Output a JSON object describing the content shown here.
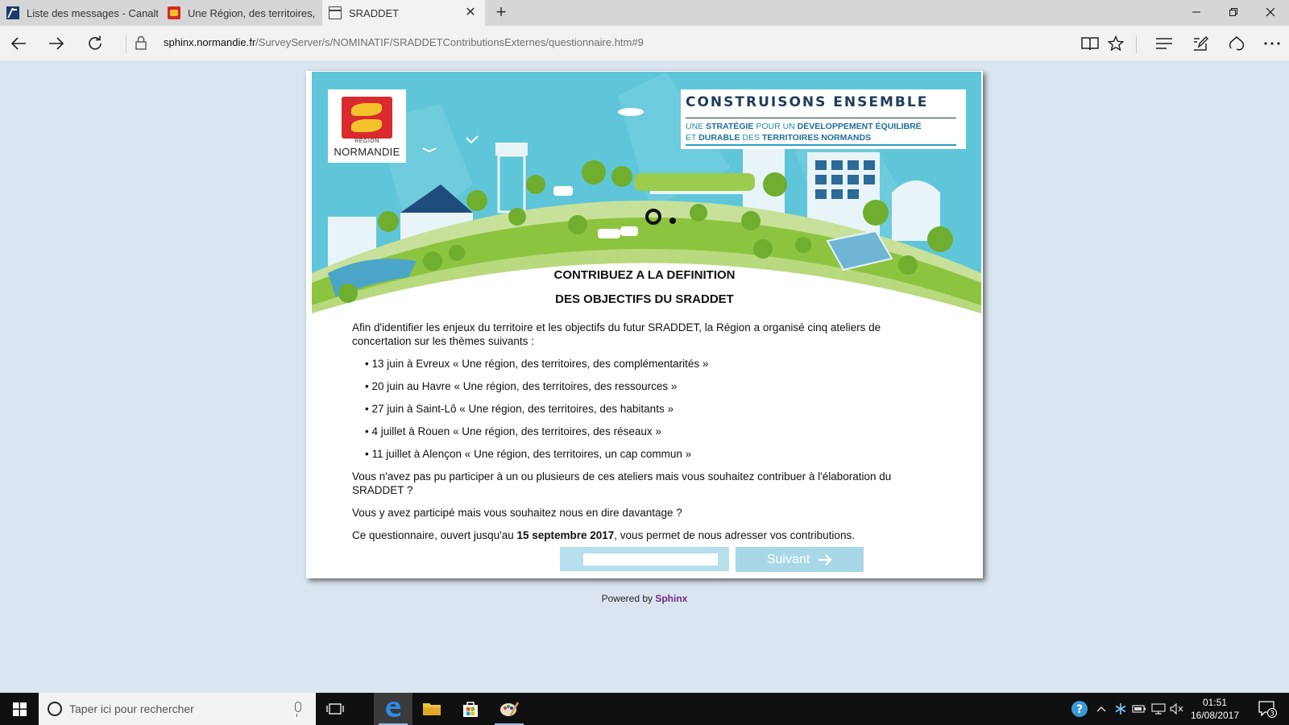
{
  "browser": {
    "tabs": [
      {
        "title": "Liste des messages - Canalt",
        "favicon": "outlook-icon"
      },
      {
        "title": "Une Région, des territoires,",
        "favicon": "region-normandie-icon"
      },
      {
        "title": "SRADDET",
        "favicon": "page-icon",
        "active": true
      }
    ],
    "url_host": "sphinx.normandie.fr",
    "url_path": "/SurveyServer/s/NOMINATIF/SRADDETContributionsExternes/questionnaire.htm#9"
  },
  "banner": {
    "logo_small": "RÉGION",
    "logo_big": "NORMANDIE",
    "slogan_title": "CONSTRUISONS ENSEMBLE",
    "slogan_line1_a": "UNE ",
    "slogan_line1_b": "STRATÉGIE",
    "slogan_line1_c": " POUR UN ",
    "slogan_line1_d": "DÉVELOPPEMENT ÉQUILIBRÉ",
    "slogan_line2_a": "ET ",
    "slogan_line2_b": "DURABLE",
    "slogan_line2_c": " DES ",
    "slogan_line2_d": "TERRITOIRES NORMANDS"
  },
  "survey": {
    "heading_line1": "CONTRIBUEZ A LA DEFINITION",
    "heading_line2": "DES OBJECTIFS DU SRADDET",
    "intro": "Afin d'identifier les enjeux du territoire et les objectifs du futur SRADDET, la Région a organisé cinq ateliers de concertation sur les thèmes suivants :",
    "workshops": [
      "• 13 juin à Evreux « Une région, des territoires, des complémentarités »",
      "• 20 juin au Havre « Une région, des territoires, des ressources »",
      "• 27 juin à Saint-Lô « Une région, des territoires, des habitants »",
      "• 4 juillet à Rouen « Une région, des territoires, des réseaux »",
      "• 11 juillet à Alençon « Une région, des territoires, un cap commun »"
    ],
    "question1": "Vous n'avez pas pu participer à un ou plusieurs de ces ateliers mais vous souhaitez contribuer à l'élaboration du SRADDET ?",
    "question2": "Vous y avez participé mais vous souhaitez nous en dire davantage ?",
    "closing_before": "Ce questionnaire, ouvert jusqu'au ",
    "closing_date": "15 septembre 2017",
    "closing_after": ", vous permet de nous adresser vos contributions.",
    "progress_fraction": 0.1,
    "next_label": "Suivant"
  },
  "footer": {
    "powered_by": "Powered by",
    "brand": "Sphinx"
  },
  "taskbar": {
    "search_placeholder": "Taper ici pour rechercher",
    "time": "01:51",
    "date": "16/08/2017",
    "notifications": "3"
  },
  "colors": {
    "sky": "#5fc6d9",
    "grass": "#8cc43f",
    "button": "#a8d8e8",
    "brand": "#6b2b8a"
  }
}
